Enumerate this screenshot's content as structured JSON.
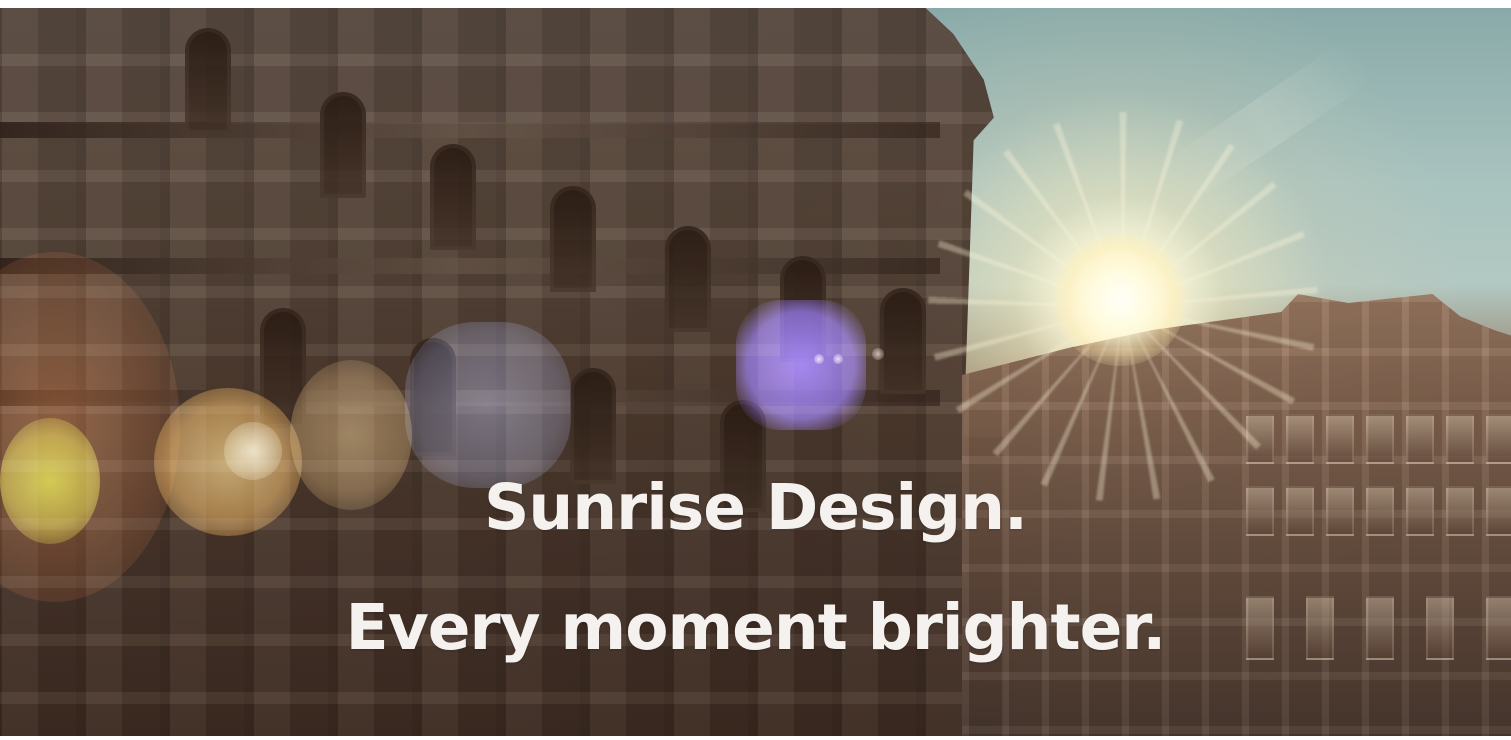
{
  "hero": {
    "headline": {
      "line1": "Sunrise Design.",
      "line2": "Every moment brighter."
    }
  }
}
